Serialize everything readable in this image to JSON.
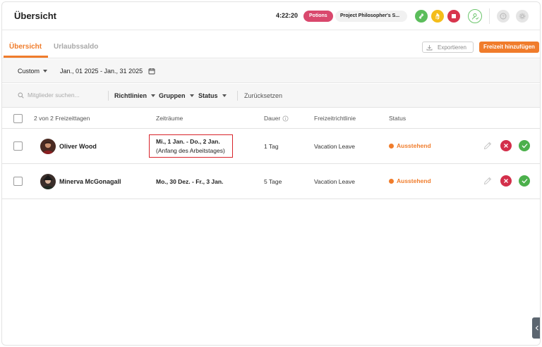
{
  "header": {
    "title": "Übersicht",
    "timer": "4:22:20",
    "project_tag": "Potions",
    "project_name": "Project Philosopher's S...",
    "icons": [
      "switch-icon",
      "break-icon",
      "stop-icon",
      "user-check-icon",
      "help-icon",
      "settings-icon"
    ]
  },
  "tabs": [
    {
      "label": "Übersicht",
      "active": true
    },
    {
      "label": "Urlaubssaldo",
      "active": false
    }
  ],
  "toolbar": {
    "export_label": "Exportieren",
    "add_label": "Freizeit hinzufügen"
  },
  "date_filter": {
    "preset": "Custom",
    "range": "Jan., 01 2025 - Jan., 31 2025"
  },
  "filters": {
    "search_placeholder": "Mitglieder suchen...",
    "policies": "Richtlinien",
    "groups": "Gruppen",
    "status": "Status",
    "reset": "Zurücksetzen"
  },
  "table": {
    "headers": {
      "count": "2 von 2 Freizeittagen",
      "periods": "Zeiträume",
      "duration": "Dauer",
      "policy": "Freizeitrichtlinie",
      "status": "Status"
    },
    "rows": [
      {
        "name": "Oliver Wood",
        "period": "Mi., 1 Jan. - Do., 2 Jan.",
        "period_note": "(Anfang des Arbeitstages)",
        "duration": "1 Tag",
        "policy": "Vacation Leave",
        "status": "Ausstehend"
      },
      {
        "name": "Minerva McGonagall",
        "period": "Mo., 30 Dez. - Fr., 3 Jan.",
        "period_note": "",
        "duration": "5 Tage",
        "policy": "Vacation Leave",
        "status": "Ausstehend"
      }
    ]
  },
  "colors": {
    "accent": "#f07c2b",
    "project_tag": "#d9486d",
    "reject": "#d32f4a",
    "approve": "#4cb04c",
    "highlight": "#d8232a"
  }
}
